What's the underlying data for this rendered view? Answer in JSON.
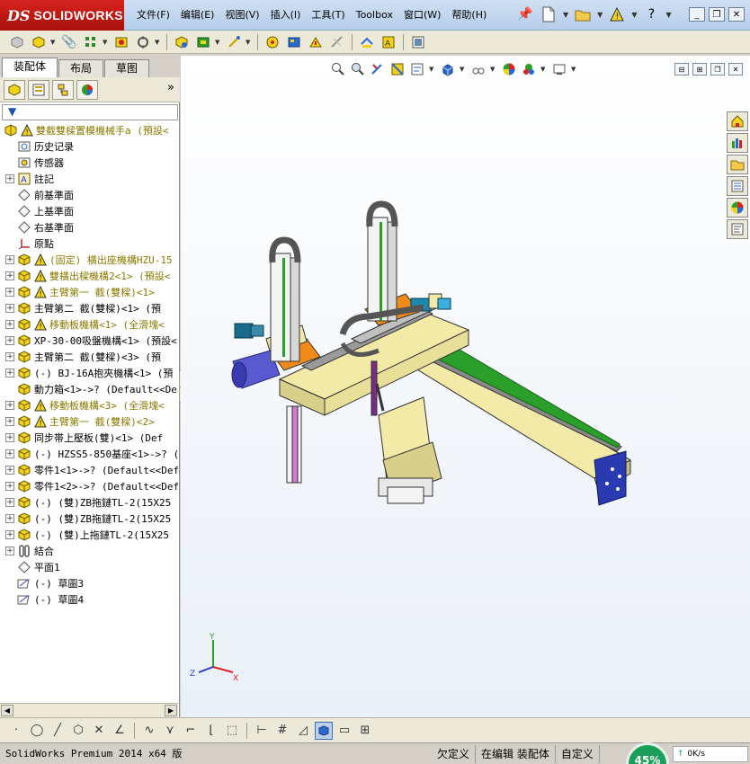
{
  "app": {
    "logo_ds": "DS",
    "logo_name": "SOLIDWORKS"
  },
  "menu": {
    "items": [
      "文件(F)",
      "编辑(E)",
      "视图(V)",
      "插入(I)",
      "工具(T)",
      "Toolbox",
      "窗口(W)",
      "帮助(H)"
    ]
  },
  "left_panel": {
    "tabs": [
      "装配体",
      "布局",
      "草图"
    ],
    "active_tab": 0,
    "more": "»"
  },
  "tree": {
    "root_label": "雙截雙樑置模機械手a  (預設<",
    "items": [
      {
        "label": "历史记录",
        "icon": "history-icon",
        "expand": "",
        "warn": false
      },
      {
        "label": "传感器",
        "icon": "sensor-icon",
        "expand": "",
        "warn": false
      },
      {
        "label": "註記",
        "icon": "annotation-icon",
        "expand": "+",
        "warn": false
      },
      {
        "label": "前基準面",
        "icon": "plane-icon",
        "expand": "",
        "warn": false
      },
      {
        "label": "上基準面",
        "icon": "plane-icon",
        "expand": "",
        "warn": false
      },
      {
        "label": "右基準面",
        "icon": "plane-icon",
        "expand": "",
        "warn": false
      },
      {
        "label": "原點",
        "icon": "origin-icon",
        "expand": "",
        "warn": false
      },
      {
        "label": "(固定) 橫出座機構HZU-15",
        "icon": "assembly-icon",
        "expand": "+",
        "warn": true
      },
      {
        "label": "雙橫出樑機構2<1> (預設<",
        "icon": "assembly-icon",
        "expand": "+",
        "warn": true
      },
      {
        "label": "主臂第一 截(雙樑)<1>",
        "icon": "assembly-icon",
        "expand": "+",
        "warn": true
      },
      {
        "label": "主臂第二 截(雙樑)<1> (預",
        "icon": "assembly-icon",
        "expand": "+",
        "warn": false
      },
      {
        "label": "移動板機構<1> (全滑塊<",
        "icon": "assembly-icon",
        "expand": "+",
        "warn": true
      },
      {
        "label": "XP-30-00吸盤機構<1> (預設<",
        "icon": "assembly-icon",
        "expand": "+",
        "warn": false
      },
      {
        "label": "主臂第二 截(雙樑)<3> (預",
        "icon": "assembly-icon",
        "expand": "+",
        "warn": false
      },
      {
        "label": "(-) BJ-16A抱夾機構<1> (預",
        "icon": "assembly-icon",
        "expand": "+",
        "warn": false
      },
      {
        "label": "動力箱<1>->? (Default<<Def",
        "icon": "part-icon",
        "expand": "",
        "warn": false
      },
      {
        "label": "移動板機構<3> (全滑塊<",
        "icon": "assembly-icon",
        "expand": "+",
        "warn": true
      },
      {
        "label": "主臂第一 截(雙樑)<2>",
        "icon": "assembly-icon",
        "expand": "+",
        "warn": true
      },
      {
        "label": "同步帯上壓板(雙)<1> (Def",
        "icon": "assembly-icon",
        "expand": "+",
        "warn": false
      },
      {
        "label": "(-) HZSS5-850基座<1>->? (D",
        "icon": "assembly-icon",
        "expand": "+",
        "warn": false
      },
      {
        "label": "零件1<1>->? (Default<<Defa",
        "icon": "assembly-icon",
        "expand": "+",
        "warn": false
      },
      {
        "label": "零件1<2>->? (Default<<Defa",
        "icon": "assembly-icon",
        "expand": "+",
        "warn": false
      },
      {
        "label": "(-) (雙)ZB拖鏈TL-2(15X25",
        "icon": "assembly-icon",
        "expand": "+",
        "warn": false
      },
      {
        "label": "(-) (雙)ZB拖鏈TL-2(15X25",
        "icon": "assembly-icon",
        "expand": "+",
        "warn": false
      },
      {
        "label": "(-) (雙)上拖鏈TL-2(15X25",
        "icon": "assembly-icon",
        "expand": "+",
        "warn": false
      },
      {
        "label": "結合",
        "icon": "mate-icon",
        "expand": "+",
        "warn": false
      },
      {
        "label": "平面1",
        "icon": "plane-icon",
        "expand": "",
        "warn": false
      },
      {
        "label": "(-) 草圖3",
        "icon": "sketch-icon",
        "expand": "",
        "warn": false
      },
      {
        "label": "(-) 草圖4",
        "icon": "sketch-icon",
        "expand": "",
        "warn": false
      }
    ]
  },
  "graphics": {
    "triad": {
      "x": "X",
      "y": "Y",
      "z": "Z"
    }
  },
  "status_bar": {
    "product": "SolidWorks Premium 2014 x64 版",
    "defined": "欠定义",
    "editing": "在编辑 装配体",
    "custom": "自定义"
  },
  "tray": {
    "gauge": "45%",
    "net_speed": "0K/s"
  },
  "colors": {
    "logo_red": "#c2191a",
    "warning_yellow": "#f3d21a",
    "gauge_green": "#1aa05a"
  }
}
